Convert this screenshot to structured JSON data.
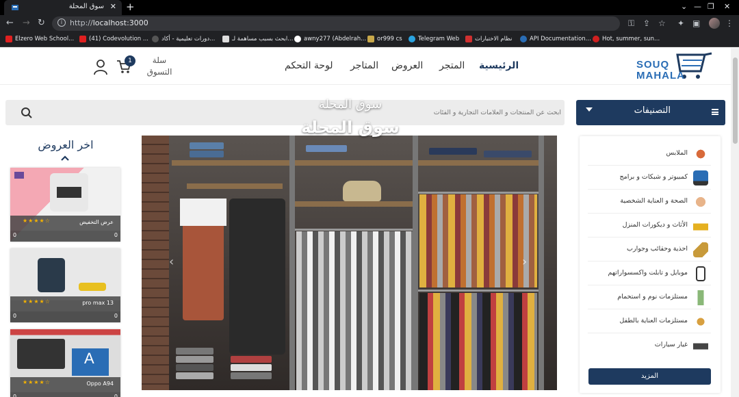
{
  "browser": {
    "tab_title": "سوق المحلة",
    "url_host": "http://",
    "url_path": "localhost:3000",
    "bookmarks": [
      "Elzero Web School...",
      "(41) Codevolution ...",
      "دورات تعليمية - أكاد...",
      "ابحث بسبب مساهمة لـ...",
      "awny277 (Abdelrah...",
      "or999 cs",
      "Telegram Web",
      "نظام الاختبارات",
      "API Documentation...",
      "Hot, summer, sun..."
    ]
  },
  "header": {
    "logo_line1": "SOUQ",
    "logo_line2": "MAHALA",
    "nav": [
      "الرئيسية",
      "المتجر",
      "العروض",
      "المتاجر",
      "لوحة التحكم"
    ],
    "cart_label_1": "سلة",
    "cart_label_2": "التسوق",
    "cart_count": "1"
  },
  "search": {
    "placeholder": "ابحث عن المنتجات و العلامات التجارية و الفئات"
  },
  "categories": {
    "title": "التصنيفات",
    "items": [
      "الملابس",
      "كمبيوتر و شبكات و برامج",
      "الصحة و العناية الشخصية",
      "الأثاث و ديكورات المنزل",
      "احذية وحقائب وجوارب",
      "موبايل و تابلت واكسسواراتهم",
      "مستلزمات نوم و استحمام",
      "مستلزمات العناية بالطفل",
      "غيار سيارات"
    ],
    "more": "المزيد"
  },
  "hero": {
    "subtitle": "سوق المحلة",
    "title": "سوق المحلة"
  },
  "offers": {
    "title": "اخر العروض",
    "items": [
      {
        "name": "عرض التخفيض",
        "stars": "★★★★☆",
        "left": "0",
        "right": "0"
      },
      {
        "name": "13 pro max",
        "stars": "★★★★☆",
        "left": "0",
        "right": "0"
      },
      {
        "name": "Oppo A94",
        "stars": "★★★★☆",
        "left": "0",
        "right": "0"
      }
    ]
  },
  "colors": {
    "brand": "#1e3a5f",
    "logo": "#2a6db5",
    "star": "#f5b301"
  }
}
